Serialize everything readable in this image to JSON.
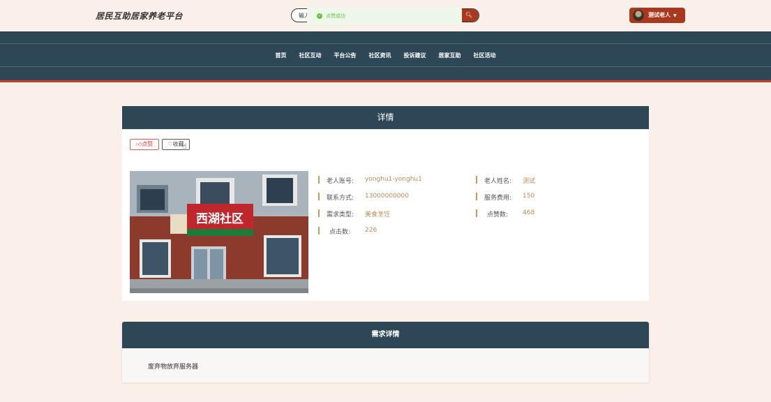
{
  "header": {
    "brand": "居民互助居家养老平台",
    "search_value": "输入",
    "search_btn_icon": "search-icon",
    "toast": "点赞成功",
    "user_name": "测试老人",
    "colors": {
      "accent": "#a9391e",
      "nav_bg": "#2d4756",
      "page_bg": "#fbf0e9"
    }
  },
  "nav": {
    "items": [
      "首页",
      "社区互动",
      "平台公告",
      "社区资讯",
      "投诉建议",
      "居家互助",
      "社区活动"
    ]
  },
  "detail": {
    "title": "详情",
    "like_label": "点赞",
    "fav_label": "收藏",
    "photo_sign": "西湖社区",
    "fields": {
      "account_label": "老人账号:",
      "account_value": "yonghu1-yonghu1",
      "name_label": "老人姓名:",
      "name_value": "测试",
      "contact_label": "联系方式:",
      "contact_value": "13000000000",
      "fee_label": "服务费用:",
      "fee_value": "150",
      "type_label": "需求类型:",
      "type_value": "美食烹饪",
      "likes_label": "点赞数:",
      "likes_value": "468",
      "clicks_label": "点击数:",
      "clicks_value": "226"
    }
  },
  "requirement": {
    "title": "需求详情",
    "body": "废弃物放弃服务器"
  }
}
